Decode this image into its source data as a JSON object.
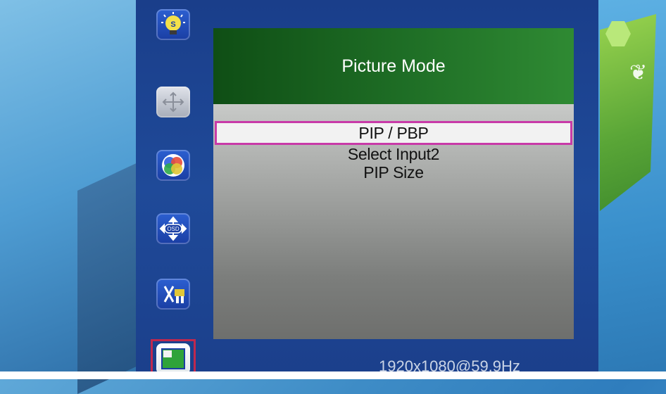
{
  "osd": {
    "title": "Picture Mode",
    "menu_items": [
      "PIP / PBP",
      "Select Input2",
      "PIP Size"
    ],
    "selected_index": 0,
    "resolution": "1920x1080@59.9Hz",
    "sidebar_icons": [
      "brightness-icon",
      "position-icon",
      "color-icon",
      "osd-settings-icon",
      "tools-icon",
      "pip-icon"
    ],
    "active_icon": "pip-icon"
  },
  "colors": {
    "header_green": "#1f6f26",
    "selection_border": "#c83aa8",
    "active_icon_border": "#c0284e",
    "osd_blue": "#1f4a99"
  },
  "icon_text": {
    "brightness": "S",
    "osd": "OSD"
  }
}
